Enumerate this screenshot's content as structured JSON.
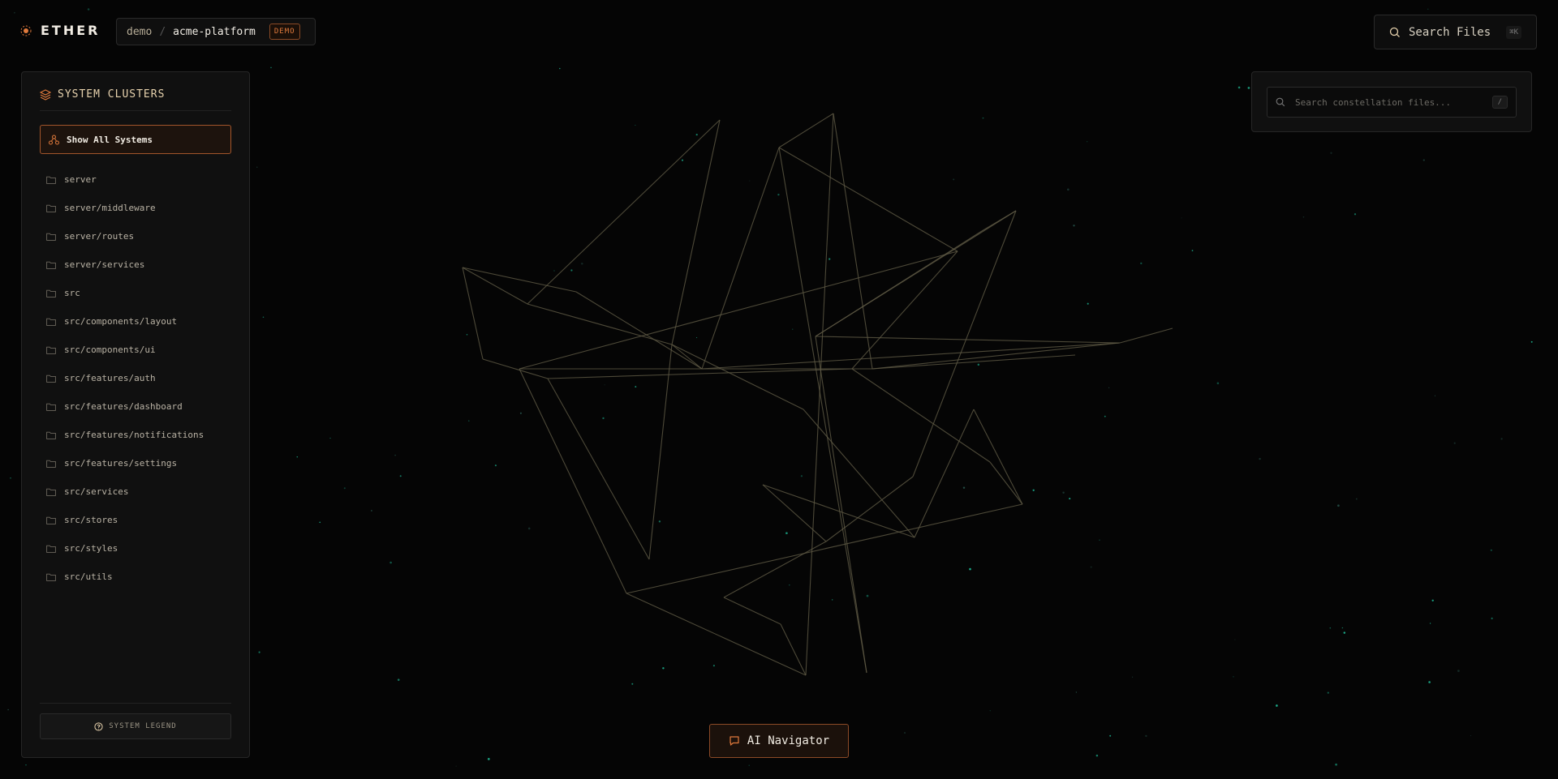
{
  "brand": {
    "name": "ETHER"
  },
  "breadcrumb": {
    "owner": "demo",
    "separator": "/",
    "repo": "acme-platform",
    "badge": "DEMO"
  },
  "top_search": {
    "label": "Search Files",
    "shortcut": "⌘K"
  },
  "sidebar": {
    "title": "SYSTEM CLUSTERS",
    "show_all_label": "Show All Systems",
    "clusters": [
      "server",
      "server/middleware",
      "server/routes",
      "server/services",
      "src",
      "src/components/layout",
      "src/components/ui",
      "src/features/auth",
      "src/features/dashboard",
      "src/features/notifications",
      "src/features/settings",
      "src/services",
      "src/stores",
      "src/styles",
      "src/utils"
    ],
    "legend_label": "SYSTEM LEGEND"
  },
  "constellation_search": {
    "placeholder": "Search constellation files...",
    "shortcut": "/"
  },
  "ai_navigator": {
    "label": "AI Navigator"
  },
  "colors": {
    "background": "#050505",
    "accent": "#e07a3c",
    "edge": "#5f5a45",
    "star": "#1fbf9a"
  },
  "icons": {
    "brand": "sun-icon",
    "search": "search-icon",
    "layers": "layers-icon",
    "cluster": "network-icon",
    "folder": "folder-icon",
    "help": "help-circle-icon",
    "chat": "chat-icon"
  }
}
